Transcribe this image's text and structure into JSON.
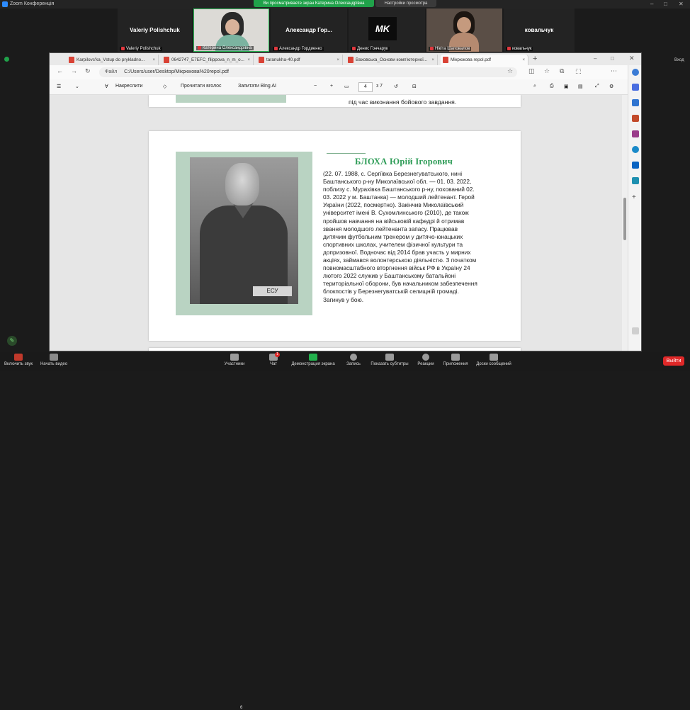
{
  "zoom": {
    "app_title": "Zoom Конференція",
    "share_banner": "Ви просматриваете экран Катерина Олександрівна",
    "view_settings": "Настройки просмотра",
    "window_controls": [
      "–",
      "□",
      "✕"
    ],
    "right_label": "Вход"
  },
  "participants": [
    {
      "display": "Valeriy Polishchuk",
      "label": "Valeriy Polishchuk",
      "video": false
    },
    {
      "display": "",
      "label": "Катерина Олександрівна",
      "video": true
    },
    {
      "display": "Александр Гор...",
      "label": "Александр Гордиенко",
      "video": false
    },
    {
      "display": "MK",
      "label": "Денис Гончарук",
      "video": false
    },
    {
      "display": "",
      "label": "Нікіта Шаповалов",
      "video": true
    },
    {
      "display": "ковальчук",
      "label": "ковальчук",
      "video": false
    }
  ],
  "browser": {
    "tabs": [
      {
        "label": "Karpilovs'ka_Vstup do prykladno...",
        "active": false
      },
      {
        "label": "0642747_E7EFC_filippova_n_m_o...",
        "active": false
      },
      {
        "label": "taranukha-40.pdf",
        "active": false
      },
      {
        "label": "Ваховська_Основи комп'ютерної...",
        "active": false
      },
      {
        "label": "Мікрюкова repol.pdf",
        "active": true
      }
    ],
    "new_tab": "+",
    "address_prefix": "Файл",
    "address": "C:/Users/user/Desktop/Мікрюкова%20repol.pdf"
  },
  "pdf_toolbar": {
    "draw": "Накреслити",
    "read_aloud": "Прочитати вголос",
    "ask_bing": "Запитати Bing AI",
    "minus": "−",
    "plus": "+",
    "page_current": "4",
    "page_total": "з 7"
  },
  "document": {
    "prev_page_text": "під час виконання бойового завдання.",
    "photo_label": "ЕСУ",
    "name": "БЛОХА Юрій Ігорович",
    "bio_lines": [
      "(22. 07. 1988, с. Сергіївка Березнегуватського, нині",
      "Баштанського р-ну Миколаївської обл. — 01. 03. 2022,",
      "поблизу с. Мурахівка Баштанського р-ну, похований 02.",
      "03. 2022 у м. Баштанка) — молодший лейтенант. Герой",
      "України (2022, посмертно). Закінчив Миколаївський",
      "університет імені В. Сухомлинського (2010), де також",
      "пройшов навчання на військовій кафедрі й отримав",
      "звання молодшого лейтенанта запасу. Працював",
      "дитячим футбольним тренером у дитячо-юнацьких",
      "спортивних школах, учителем фізичної культури та",
      "допризовної. Водночас від 2014 брав участь у мирних",
      "акціях, займався волонтерською діяльністю. З початком",
      "повномасштабного вторгнення військ РФ в Україну 24",
      "лютого 2022 служив у Баштанському батальйоні",
      "територіальної оборони, був начальником забезпечення",
      "блокпостів у Березнегуватській селищній громаді.",
      "Загинув у бою."
    ]
  },
  "zoom_toolbar": {
    "mute": "Включить звук",
    "video": "Начать видео",
    "participants": "Участники",
    "participants_count": "6",
    "chat": "Чат",
    "chat_badge": "1",
    "share": "Демонстрация экрана",
    "record": "Запись",
    "captions": "Показать субтитры",
    "reactions": "Реакции",
    "apps": "Приложения",
    "whiteboards": "Доски сообщений",
    "leave": "Выйти"
  }
}
